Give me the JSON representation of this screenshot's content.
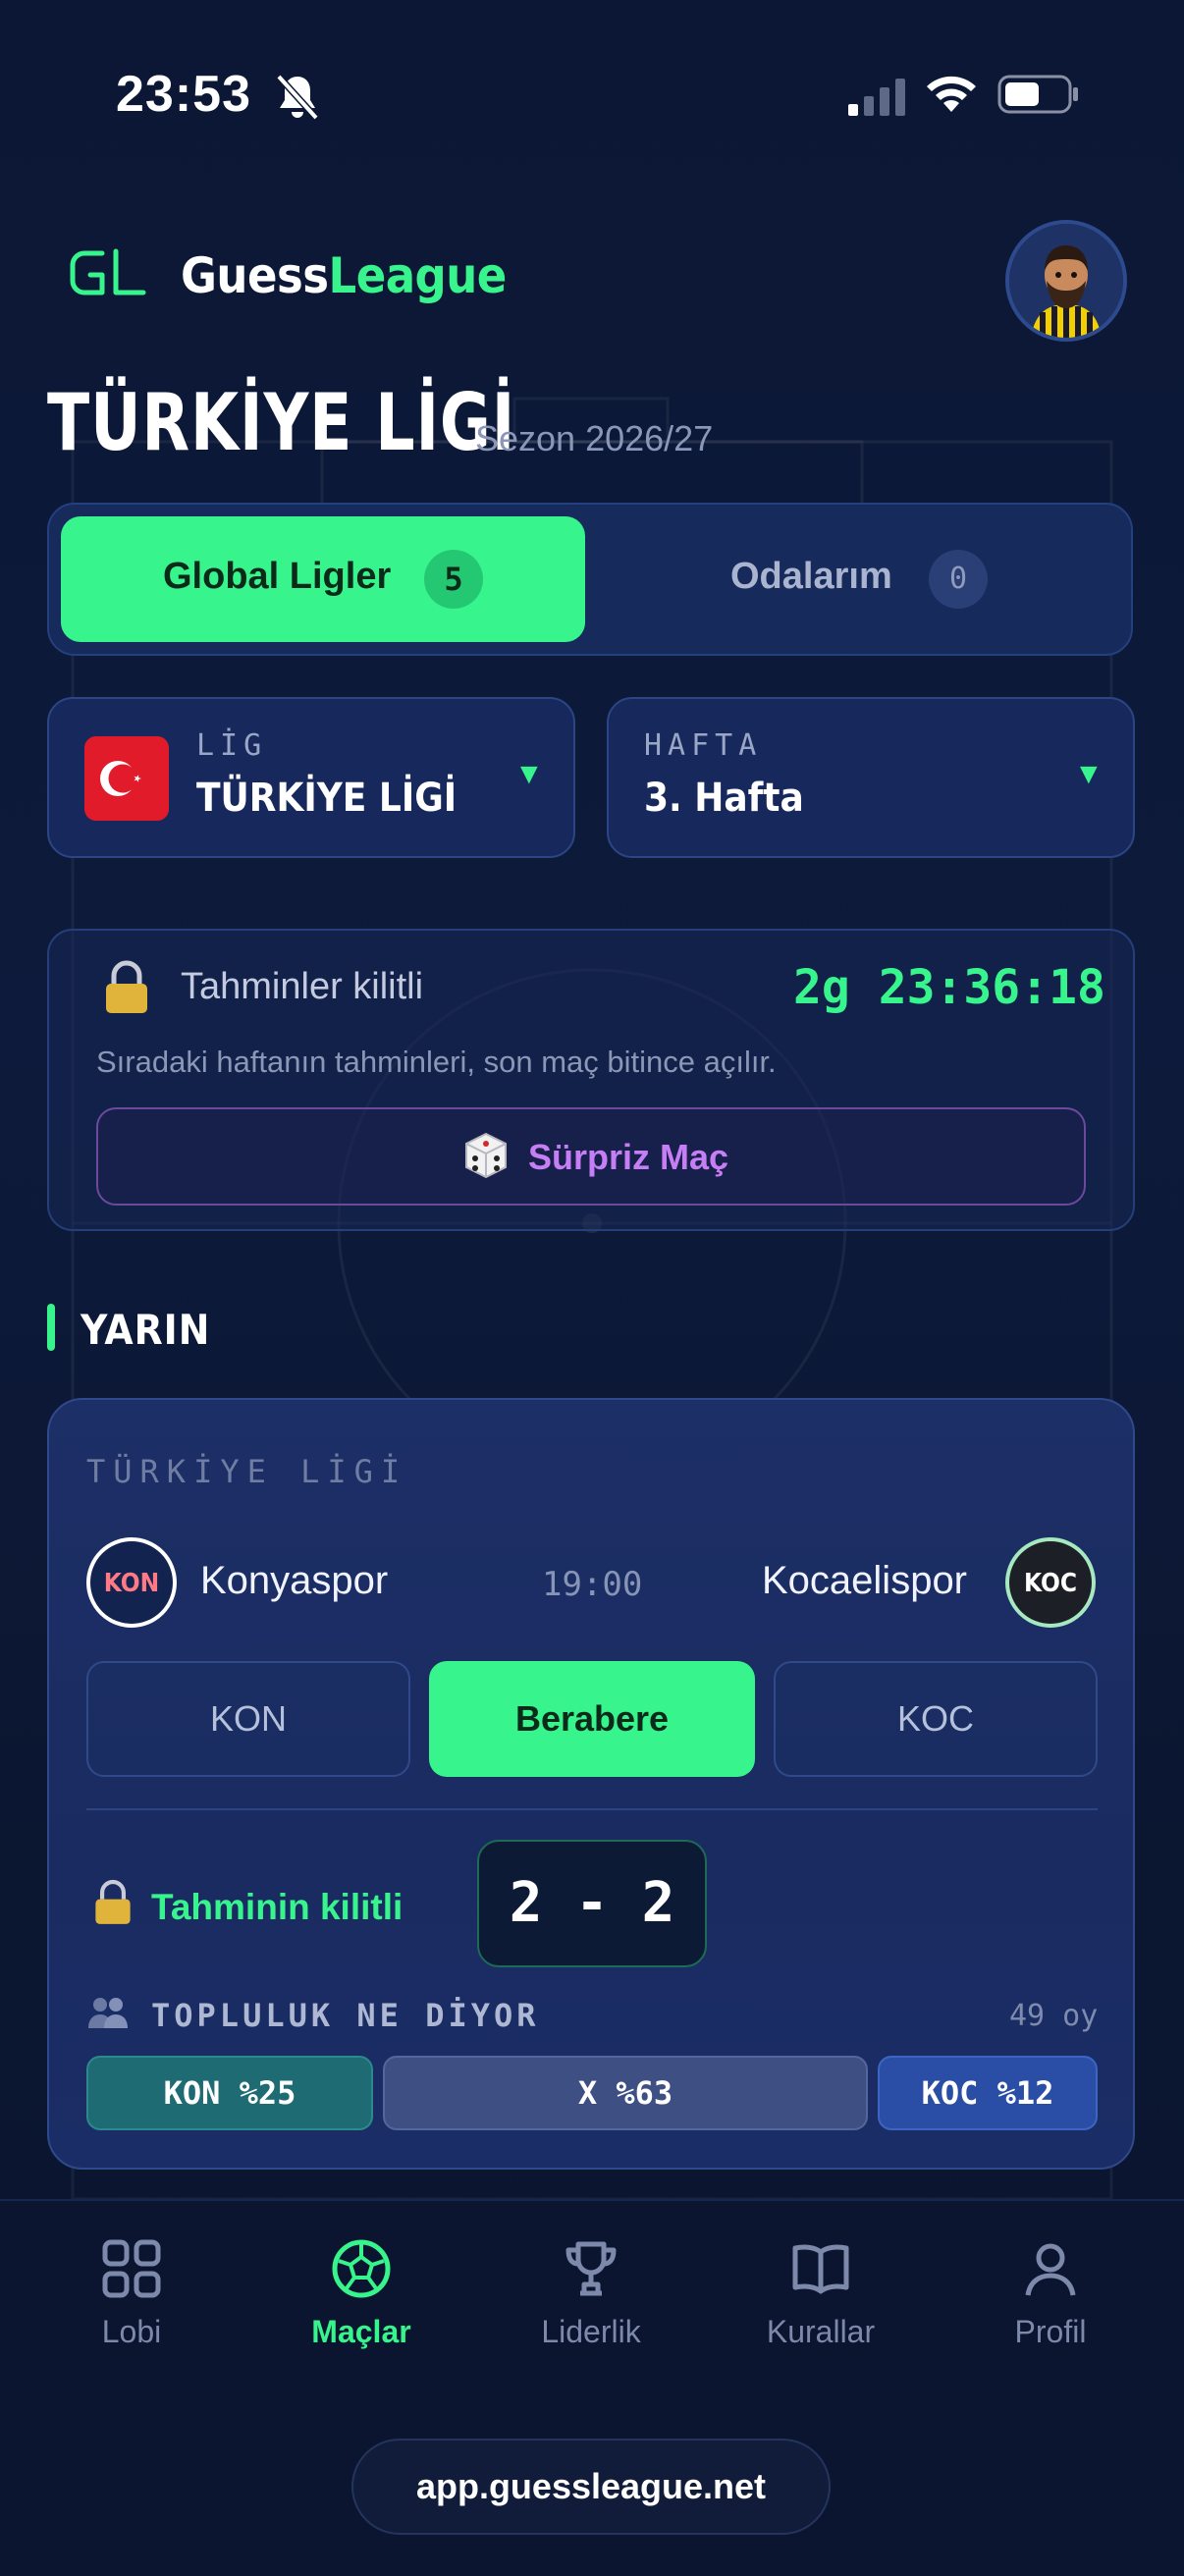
{
  "status_bar": {
    "time": "23:53"
  },
  "header": {
    "brand_first": "Guess",
    "brand_second": "League",
    "logo": "GL"
  },
  "page": {
    "title": "TÜRKİYE LİGİ",
    "season": "Sezon 2026/27"
  },
  "tabs": [
    {
      "label": "Global Ligler",
      "count": "5",
      "active": true
    },
    {
      "label": "Odalarım",
      "count": "0",
      "active": false
    }
  ],
  "selectors": {
    "league": {
      "caption": "LİG",
      "value": "TÜRKİYE LİGİ"
    },
    "week": {
      "caption": "HAFTA",
      "value": "3. Hafta"
    }
  },
  "lock_card": {
    "title": "Tahminler kilitli",
    "countdown": "2g 23:36:18",
    "description": "Sıradaki haftanın tahminleri, son maç bitince açılır.",
    "surprise_button": "Sürpriz Maç"
  },
  "section": {
    "title": "YARIN"
  },
  "match": {
    "league": "TÜRKİYE LİGİ",
    "home": {
      "code": "KON",
      "name": "Konyaspor"
    },
    "away": {
      "code": "KOC",
      "name": "Kocaelispor"
    },
    "time": "19:00",
    "picks": {
      "home": "KON",
      "draw": "Berabere",
      "away": "KOC",
      "selected": "draw"
    },
    "locked_label": "Tahminin kilitli",
    "score": "2 - 2",
    "community": {
      "label": "TOPLULUK NE DİYOR",
      "votes": "49 oy",
      "home": "KON %25",
      "draw": "X %63",
      "away": "KOC %12",
      "home_pct": 25,
      "draw_pct": 63,
      "away_pct": 12
    }
  },
  "nav": [
    {
      "label": "Lobi",
      "icon": "grid-icon"
    },
    {
      "label": "Maçlar",
      "icon": "football-icon",
      "active": true
    },
    {
      "label": "Liderlik",
      "icon": "trophy-icon"
    },
    {
      "label": "Kurallar",
      "icon": "book-icon"
    },
    {
      "label": "Profil",
      "icon": "user-icon"
    }
  ],
  "url": "app.guessleague.net",
  "colors": {
    "accent": "#37f48d",
    "background": "#0d1a3b",
    "card": "#1c2f66",
    "surprise": "#c67ef5"
  }
}
